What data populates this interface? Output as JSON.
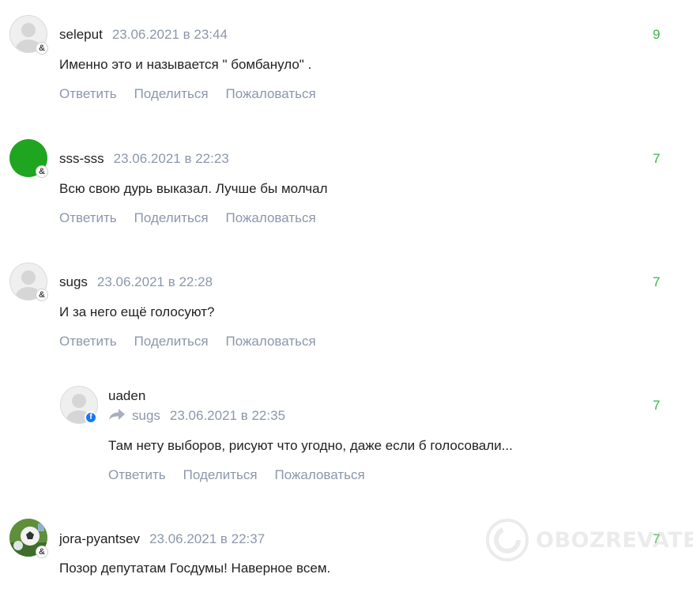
{
  "actions": {
    "reply": "Ответить",
    "share": "Поделиться",
    "report": "Пожаловаться"
  },
  "comments": [
    {
      "author": "seleput",
      "date": "23.06.2021 в 23:44",
      "rating": "9",
      "text": "Именно это и называется \" бомбануло\" .",
      "avatar": "default-user-icon",
      "source_badge": "&"
    },
    {
      "author": "sss-sss",
      "date": "23.06.2021 в 22:23",
      "rating": "7",
      "text": "Всю свою дурь выказал. Лучше бы молчал",
      "avatar": "green-circle",
      "avatar_color": "#1fa51f",
      "source_badge": "&"
    },
    {
      "author": "sugs",
      "date": "23.06.2021 в 22:28",
      "rating": "7",
      "text": "И за него ещё голосуют?",
      "avatar": "default-user-icon",
      "source_badge": "&"
    },
    {
      "author": "uaden",
      "reply_to": "sugs",
      "date": "23.06.2021 в 22:35",
      "rating": "7",
      "text": "Там нету выборов, рисуют что угодно, даже если б голосовали...",
      "avatar": "default-user-icon",
      "source_badge": "f"
    },
    {
      "author": "jora-pyantsev",
      "date": "23.06.2021 в 22:37",
      "rating": "7",
      "text": "Позор депутатам Госдумы! Наверное всем.",
      "avatar": "photo-soccer-ball",
      "source_badge": "&"
    }
  ],
  "watermark": "OBOZREVATEL",
  "colors": {
    "rating_positive": "#3ab54a",
    "meta_gray": "#8c97ab",
    "text": "#222222"
  }
}
